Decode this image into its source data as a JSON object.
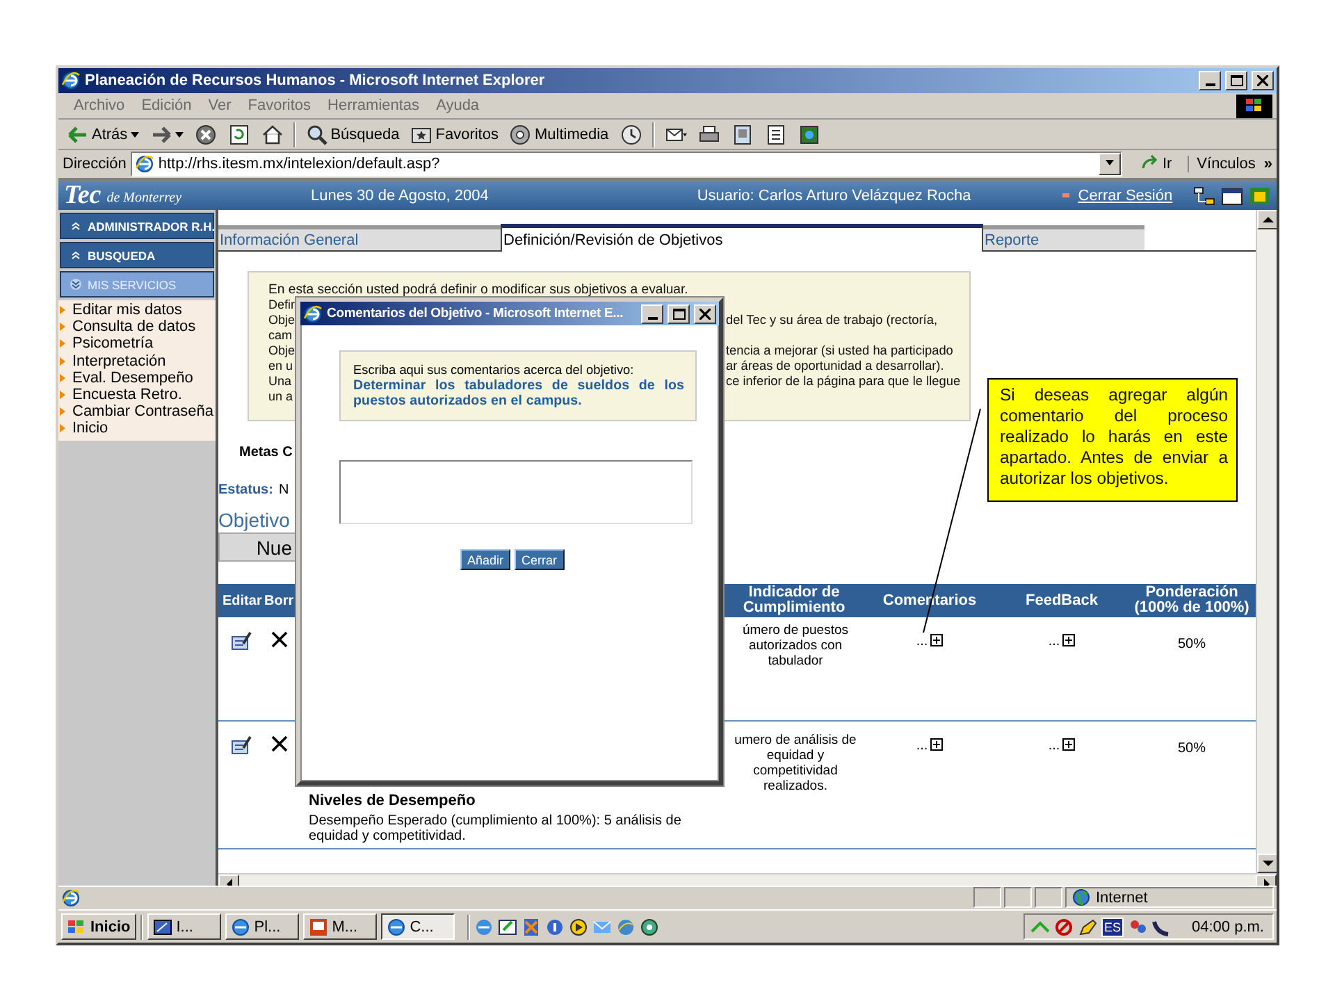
{
  "browser": {
    "title": "Planeación de Recursos Humanos - Microsoft Internet Explorer",
    "menu": [
      "Archivo",
      "Edición",
      "Ver",
      "Favoritos",
      "Herramientas",
      "Ayuda"
    ],
    "toolbar": [
      {
        "kind": "back",
        "label": "Atrás"
      },
      {
        "kind": "forward"
      },
      {
        "kind": "stop"
      },
      {
        "kind": "refresh"
      },
      {
        "kind": "home"
      },
      {
        "kind": "search",
        "label": "Búsqueda"
      },
      {
        "kind": "favorites",
        "label": "Favoritos"
      },
      {
        "kind": "media",
        "label": "Multimedia"
      },
      {
        "kind": "history"
      },
      {
        "kind": "mail"
      },
      {
        "kind": "print"
      },
      {
        "kind": "edit"
      },
      {
        "kind": "discuss"
      },
      {
        "kind": "messenger"
      }
    ],
    "address": {
      "label": "Dirección",
      "value": "http://rhs.itesm.mx/intelexion/default.asp?",
      "go": "Ir",
      "links": "Vínculos",
      "more": "»"
    }
  },
  "header": {
    "logo": "Tec",
    "logo_sub": "de Monterrey",
    "date": "Lunes 30 de Agosto, 2004",
    "user": "Usuario: Carlos Arturo Velázquez Rocha",
    "logout": "Cerrar Sesión"
  },
  "sidebar": {
    "sections": [
      {
        "label": "ADMINISTRADOR R.H.",
        "expanded": false
      },
      {
        "label": "BUSQUEDA",
        "expanded": false
      },
      {
        "label": "MIS SERVICIOS",
        "expanded": true
      }
    ],
    "items": [
      "Editar mis datos",
      "Consulta de datos",
      "Psicometría",
      "Interpretación",
      "Eval. Desempeño",
      "Encuesta Retro.",
      "Cambiar Contraseña",
      "Inicio"
    ]
  },
  "tabs": [
    {
      "label": "Información General",
      "selected": false
    },
    {
      "label": "Definición/Revisión de Objetivos",
      "selected": true
    },
    {
      "label": "Reporte",
      "selected": false
    }
  ],
  "intro": {
    "first_line": "En esta sección usted podrá definir o modificar sus objetivos a evaluar.",
    "rows": [
      {
        "left": "Defir"
      },
      {
        "left": "Obje",
        "right": "del Tec y su área de trabajo (rectoría,"
      },
      {
        "left": "cam"
      },
      {
        "left": "Obje",
        "right": "tencia a mejorar (si usted ha participado"
      },
      {
        "left": "en u",
        "right": "ar áreas de oportunidad a desarrollar)."
      },
      {
        "left": "Una",
        "right": "ce inferior de la página para que le llegue"
      },
      {
        "left": "un a"
      }
    ]
  },
  "goals_label": "Metas C",
  "status": {
    "label": "Estatus:",
    "value": "N"
  },
  "objectives_title": "Objetivo",
  "new_button": "Nue",
  "table": {
    "columns": [
      "Editar",
      "Borr",
      "Indicador de Cumplimiento",
      "Comentarios",
      "FeedBack",
      "Ponderación (100% de 100%)"
    ],
    "rows": [
      {
        "indicator": "úmero de puestos autorizados con tabulador",
        "comments": "...",
        "feedback": "...",
        "weight": "50%"
      },
      {
        "indicator": "umero de análisis de equidad y competitividad realizados.",
        "comments": "...",
        "feedback": "...",
        "weight": "50%",
        "levels": {
          "title": "Niveles de Desempeño",
          "text": "Desempeño Esperado (cumplimiento al 100%): 5 análisis de equidad y competitividad."
        }
      }
    ]
  },
  "popup": {
    "title": "Comentarios del Objetivo - Microsoft Internet E...",
    "prompt": "Escriba aqui sus comentarios acerca del objetivo:",
    "objective": "Determinar los tabuladores de sueldos de los puestos autorizados en el campus.",
    "buttons": [
      "Añadir",
      "Cerrar"
    ]
  },
  "callout": {
    "text": "Si deseas agregar algún comentario del proceso realizado lo harás en este apartado. Antes de enviar a autorizar los objetivos."
  },
  "status_bar": {
    "zone": "Internet"
  },
  "taskbar": {
    "start": "Inicio",
    "tasks": [
      {
        "kind": "app",
        "label": "I...",
        "selected": false
      },
      {
        "kind": "browser",
        "label": "Pl...",
        "selected": false
      },
      {
        "kind": "slides",
        "label": "M...",
        "selected": false
      },
      {
        "kind": "browser",
        "label": "C...",
        "selected": true
      }
    ],
    "language": "ES",
    "clock": "04:00 p.m."
  }
}
